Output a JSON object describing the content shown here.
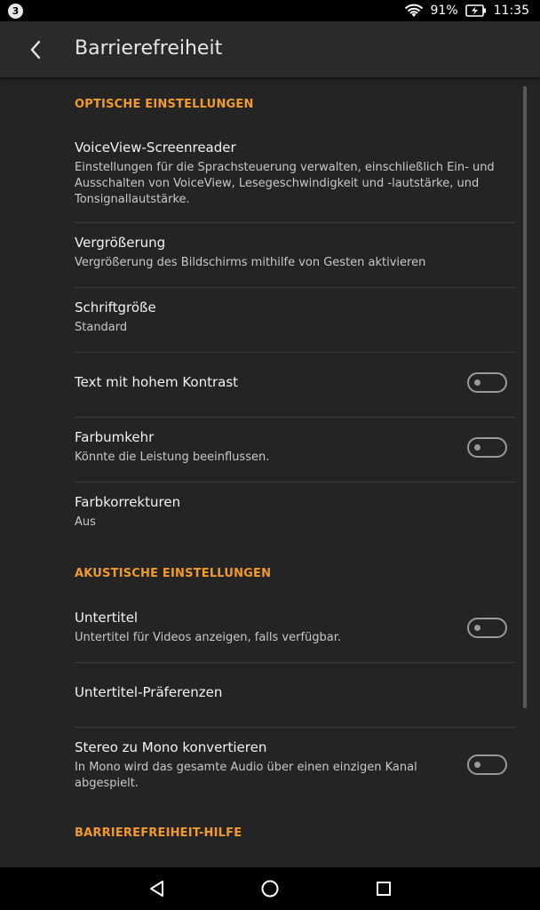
{
  "status_bar": {
    "notification_count": "3",
    "battery_percent": "91%",
    "time": "11:35"
  },
  "header": {
    "title": "Barrierefreiheit"
  },
  "sections": {
    "optical": {
      "label": "OPTISCHE EINSTELLUNGEN"
    },
    "acoustic": {
      "label": "AKUSTISCHE EINSTELLUNGEN"
    },
    "help": {
      "label": "BARRIEREFREIHEIT-HILFE"
    }
  },
  "items": {
    "voiceview": {
      "title": "VoiceView-Screenreader",
      "subtitle": "Einstellungen für die Sprachsteuerung verwalten, einschließlich Ein- und Ausschalten von VoiceView, Lesegeschwindigkeit und -lautstärke, und Tonsignallautstärke."
    },
    "magnification": {
      "title": "Vergrößerung",
      "subtitle": "Vergrößerung des Bildschirms mithilfe von Gesten aktivieren"
    },
    "font_size": {
      "title": "Schriftgröße",
      "subtitle": "Standard"
    },
    "high_contrast": {
      "title": "Text mit hohem Kontrast",
      "enabled": false
    },
    "color_inversion": {
      "title": "Farbumkehr",
      "subtitle": "Könnte die Leistung beeinflussen.",
      "enabled": false
    },
    "color_correction": {
      "title": "Farbkorrekturen",
      "subtitle": "Aus"
    },
    "captions": {
      "title": "Untertitel",
      "subtitle": "Untertitel für Videos anzeigen, falls verfügbar.",
      "enabled": false
    },
    "caption_prefs": {
      "title": "Untertitel-Präferenzen"
    },
    "mono_audio": {
      "title": "Stereo zu Mono konvertieren",
      "subtitle": "In Mono wird das gesamte Audio über einen einzigen Kanal abgespielt.",
      "enabled": false
    }
  },
  "colors": {
    "accent": "#f39a2b",
    "background": "#242424",
    "app_bar": "#2a2a2a"
  },
  "icons": {
    "back": "chevron-left-icon",
    "wifi": "wifi-icon",
    "battery": "battery-charging-icon",
    "nav_back": "triangle-back-icon",
    "nav_home": "circle-home-icon",
    "nav_recents": "square-recents-icon"
  }
}
